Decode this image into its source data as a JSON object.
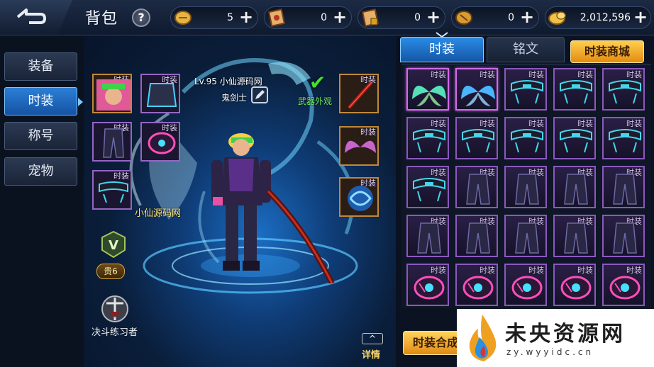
{
  "header": {
    "title": "背包",
    "help_label": "?",
    "currencies": [
      {
        "icon": "gold-coin-icon",
        "value": "5"
      },
      {
        "icon": "scroll-ticket-icon",
        "value": "0"
      },
      {
        "icon": "locked-scroll-icon",
        "value": "0"
      },
      {
        "icon": "bronze-coin-icon",
        "value": "0"
      },
      {
        "icon": "gold-ingot-icon",
        "value": "2,012,596"
      }
    ],
    "plus_label": "+"
  },
  "sidebar": {
    "items": [
      {
        "label": "装备",
        "active": false
      },
      {
        "label": "时装",
        "active": true
      },
      {
        "label": "称号",
        "active": false
      },
      {
        "label": "宠物",
        "active": false
      }
    ]
  },
  "character": {
    "level_name": "Lv.95 小仙源码网",
    "class_name": "鬼剑士",
    "weapon_appearance": "武器外观",
    "name_tag": "小仙源码网",
    "rank_badge": "V",
    "noble_label": "贵6",
    "duel_title": "决斗练习者",
    "details_label": "详情",
    "equipped_slots_label": "时装"
  },
  "right": {
    "tabs": [
      {
        "label": "时装",
        "active": true
      },
      {
        "label": "铭文",
        "active": false
      }
    ],
    "mall_button": "时装商城",
    "compose_button": "时装合成",
    "cell_label": "时装",
    "grid_rows": [
      [
        "wings-green",
        "wings-blue",
        "belt",
        "belt",
        "belt"
      ],
      [
        "belt",
        "belt",
        "belt",
        "belt",
        "belt"
      ],
      [
        "belt",
        "pants",
        "pants",
        "pants",
        "pants"
      ],
      [
        "pants",
        "pants",
        "pants",
        "pants",
        "pants"
      ],
      [
        "gauntlet",
        "gauntlet",
        "gauntlet",
        "gauntlet",
        "gauntlet"
      ]
    ]
  },
  "watermark": {
    "text": "未央资源网",
    "url": "zy.wyyidc.cn"
  },
  "colors": {
    "accent_blue": "#2b8ce6",
    "gold_button": "#f0a32a",
    "slot_purple": "#8a59bd",
    "confirm_green": "#3de22e"
  }
}
